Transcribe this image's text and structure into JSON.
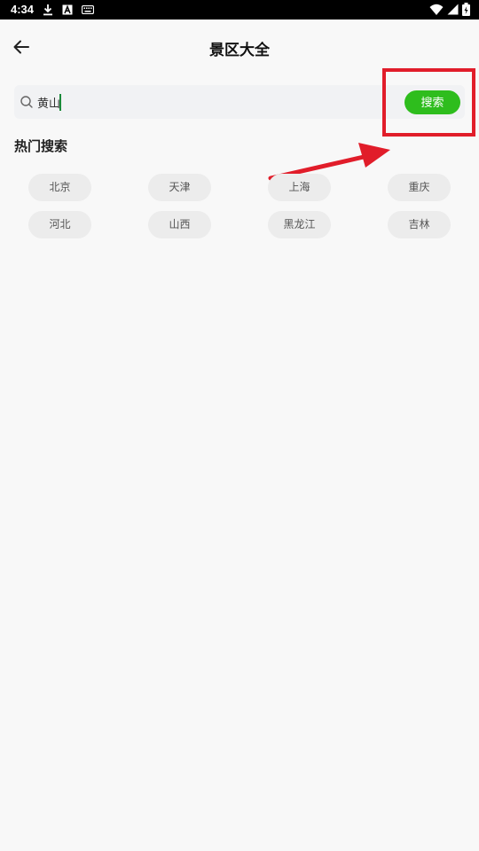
{
  "status_bar": {
    "time": "4:34",
    "left_icons": [
      "download-icon",
      "text-a-icon",
      "keyboard-icon"
    ],
    "right_icons": [
      "wifi-icon",
      "signal-icon",
      "battery-charging-icon"
    ]
  },
  "app_bar": {
    "title": "景区大全",
    "back_icon": "arrow-left-icon"
  },
  "search": {
    "value": "黄山",
    "button_label": "搜索",
    "button_color": "#2ebd1d"
  },
  "hot_search": {
    "title": "热门搜索",
    "tags": [
      "北京",
      "天津",
      "上海",
      "重庆",
      "河北",
      "山西",
      "黑龙江",
      "吉林"
    ]
  },
  "annotation": {
    "color": "#e11d2a"
  }
}
